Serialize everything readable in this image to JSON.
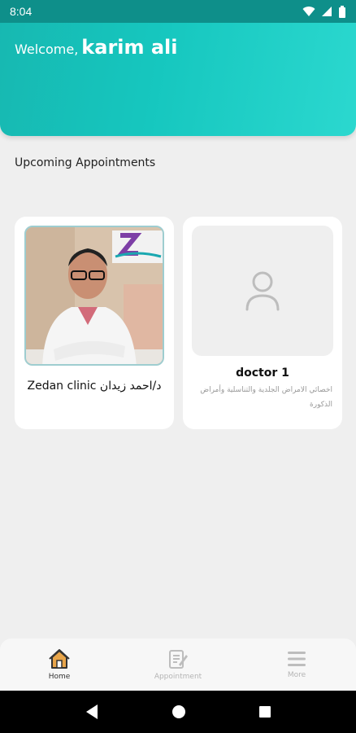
{
  "status_bar": {
    "time": "8:04"
  },
  "header": {
    "welcome_label": "Welcome,",
    "user_name": "karim ali"
  },
  "section": {
    "title": "Upcoming Appointments"
  },
  "doctors": [
    {
      "name": "Zedan clinic د/احمد زيدان",
      "description": "",
      "photo": "doctor-photo"
    },
    {
      "name": "doctor 1",
      "description": "اخصائي الامراض الجلدية والتناسلية وأمراض الذكورة",
      "photo": "user-placeholder-icon"
    }
  ],
  "bottom_nav": [
    {
      "label": "Home",
      "icon": "home-icon",
      "active": true
    },
    {
      "label": "Appointment",
      "icon": "appointment-icon",
      "active": false
    },
    {
      "label": "More",
      "icon": "menu-icon",
      "active": false
    }
  ],
  "colors": {
    "accent": "#16c7bf",
    "active_icon": "#e8a54a",
    "background": "#efefef"
  }
}
